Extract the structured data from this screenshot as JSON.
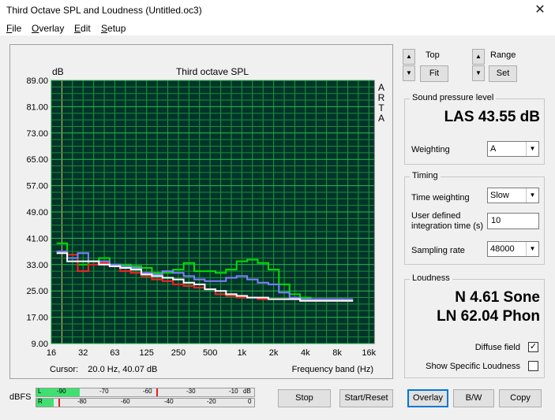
{
  "window": {
    "title": "Third Octave SPL and Loudness (Untitled.oc3)"
  },
  "menu": [
    {
      "first": "F",
      "rest": "ile"
    },
    {
      "first": "O",
      "rest": "verlay"
    },
    {
      "first": "E",
      "rest": "dit"
    },
    {
      "first": "S",
      "rest": "etup"
    }
  ],
  "chart": {
    "unit_label": "dB",
    "arta_letters": [
      "A",
      "R",
      "T",
      "A"
    ],
    "cursor": "Cursor:    20.0 Hz, 40.07 dB",
    "frequency_label": "Frequency band (Hz)"
  },
  "chart_data": {
    "type": "line",
    "title": "Third octave SPL",
    "xlabel": "Frequency band (Hz)",
    "ylabel": "dB",
    "x_bands": [
      "16",
      "20",
      "25",
      "31.5",
      "40",
      "50",
      "63",
      "80",
      "100",
      "125",
      "160",
      "200",
      "250",
      "315",
      "400",
      "500",
      "630",
      "800",
      "1k",
      "1.25k",
      "1.6k",
      "2k",
      "2.5k",
      "3.15k",
      "4k",
      "5k",
      "6.3k",
      "8k",
      "10k",
      "12.5k",
      "16k",
      "20k"
    ],
    "x_tick_labels": [
      "16",
      "32",
      "63",
      "125",
      "250",
      "500",
      "1k",
      "2k",
      "4k",
      "8k",
      "16k"
    ],
    "y_tick_labels": [
      "89.00",
      "81.00",
      "73.00",
      "65.00",
      "57.00",
      "49.00",
      "41.00",
      "33.00",
      "25.00",
      "17.00",
      "9.00"
    ],
    "ylim": [
      9,
      89
    ],
    "grid": true,
    "series": [
      {
        "color": "#00e000",
        "values": [
          39.5,
          35.0,
          33.0,
          34.0,
          35.0,
          33.0,
          33.0,
          32.5,
          32.0,
          30.5,
          30.5,
          31.5,
          33.5,
          31.0,
          31.0,
          30.5,
          31.5,
          34.0,
          34.5,
          33.5,
          31.5,
          27.0,
          24.0,
          23.0,
          22.5,
          22.5,
          22.5,
          22.0
        ]
      },
      {
        "color": "#ff2020",
        "values": [
          37.0,
          36.0,
          31.0,
          33.0,
          33.5,
          32.5,
          31.0,
          30.5,
          29.5,
          28.5,
          28.0,
          27.0,
          26.5,
          26.0,
          25.5,
          24.0,
          23.5,
          23.0,
          23.0,
          22.5,
          22.5,
          22.5,
          22.5,
          22.0,
          22.0,
          22.0,
          22.0,
          22.0
        ]
      },
      {
        "color": "#8080ff",
        "values": [
          37.0,
          35.0,
          36.5,
          34.0,
          34.0,
          33.0,
          32.5,
          32.0,
          30.5,
          30.0,
          31.0,
          30.5,
          29.5,
          28.5,
          28.0,
          28.0,
          29.0,
          29.5,
          28.5,
          27.5,
          27.0,
          24.5,
          23.0,
          22.5,
          22.5,
          22.5,
          22.5,
          22.5
        ]
      },
      {
        "color": "#ffffff",
        "values": [
          36.5,
          34.0,
          34.0,
          34.0,
          33.0,
          32.5,
          32.0,
          31.5,
          30.0,
          29.5,
          29.0,
          28.5,
          27.5,
          27.0,
          25.5,
          25.0,
          24.0,
          23.5,
          23.0,
          23.0,
          22.5,
          22.5,
          22.5,
          22.0,
          22.0,
          22.0,
          22.0,
          22.0
        ]
      }
    ]
  },
  "controls": {
    "top_label": "Top",
    "range_label": "Range",
    "fit_label": "Fit",
    "set_label": "Set"
  },
  "spl": {
    "group_title": "Sound pressure level",
    "value": "LAS 43.55 dB",
    "weighting_label": "Weighting",
    "weighting_value": "A"
  },
  "timing": {
    "group_title": "Timing",
    "time_weighting_label": "Time weighting",
    "time_weighting_value": "Slow",
    "user_defined_label_1": "User defined",
    "user_defined_label_2": "integration time (s)",
    "integration_value": "10",
    "sampling_label": "Sampling rate",
    "sampling_value": "48000"
  },
  "loudness": {
    "group_title": "Loudness",
    "sone": "N 4.61 Sone",
    "phon": "LN 62.04 Phon",
    "diffuse_label": "Diffuse field",
    "diffuse_checked": "✓",
    "specific_label": "Show Specific Loudness"
  },
  "meter": {
    "label": "dBFS",
    "L_label": "L",
    "R_label": "R",
    "L_ticks": [
      "-90",
      "-70",
      "-60",
      "-30",
      "-10",
      "dB"
    ],
    "R_ticks": [
      "-80",
      "-60",
      "-40",
      "-20",
      "0"
    ],
    "L_level": 0.2,
    "R_level": 0.08
  },
  "buttons": {
    "stop": "Stop",
    "start_reset": "Start/Reset",
    "overlay": "Overlay",
    "bw": "B/W",
    "copy": "Copy"
  }
}
